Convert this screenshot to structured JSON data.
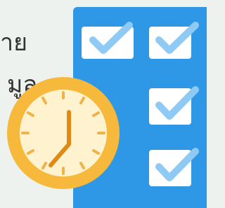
{
  "text_lines": [
    "าย",
    "มูล"
  ],
  "colors": {
    "background": "#eef2ee",
    "panel": "#2f98e6",
    "checkbox": "#ffffff",
    "check": "#8fcaf5",
    "clock_outer": "#f6b93b",
    "clock_inner": "#fff3cf",
    "clock_hand": "#e08a16",
    "text": "#333333"
  },
  "icons": {
    "checklist": "checklist-icon",
    "clock": "clock-icon",
    "check": "checkmark-icon"
  }
}
